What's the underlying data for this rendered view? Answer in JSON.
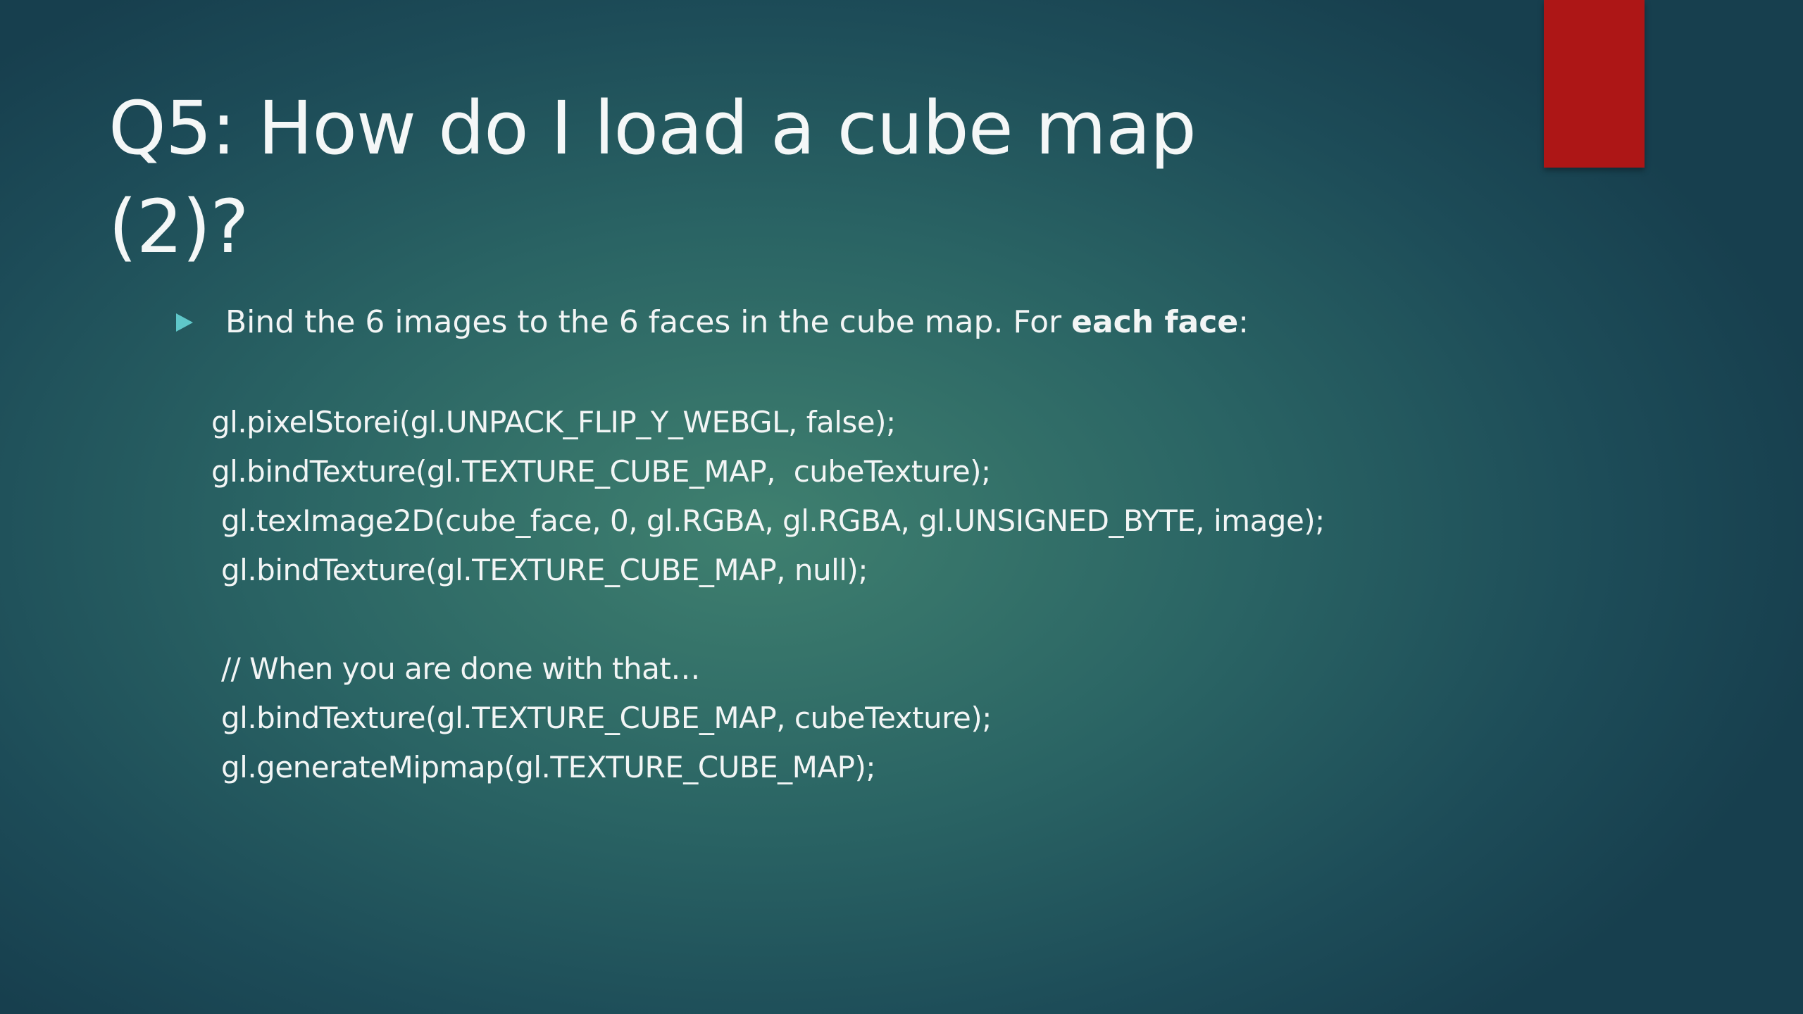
{
  "slide": {
    "title_line1": "Q5: How do I load a cube map",
    "title_line2": "(2)?",
    "bullet": {
      "icon": "triangle-bullet-icon",
      "text_before": "Bind the 6 images to the 6 faces in the cube map.  For ",
      "text_bold": "each face",
      "text_after": ":"
    },
    "code_lines": [
      "gl.pixelStorei(gl.UNPACK_FLIP_Y_WEBGL, false);",
      "gl.bindTexture(gl.TEXTURE_CUBE_MAP,  cubeTexture);",
      "gl.texImage2D(cube_face, 0, gl.RGBA, gl.RGBA, gl.UNSIGNED_BYTE, image);",
      "gl.bindTexture(gl.TEXTURE_CUBE_MAP, null);",
      "",
      "// When you are done with that…",
      "gl.bindTexture(gl.TEXTURE_CUBE_MAP, cubeTexture);",
      "gl.generateMipmap(gl.TEXTURE_CUBE_MAP);"
    ]
  },
  "colors": {
    "accent_bar": "#ad1616",
    "bullet_arrow": "#5fc7c9",
    "background_center": "#3f806f",
    "background_edge": "#173f4e",
    "text": "#f2f5f5"
  }
}
